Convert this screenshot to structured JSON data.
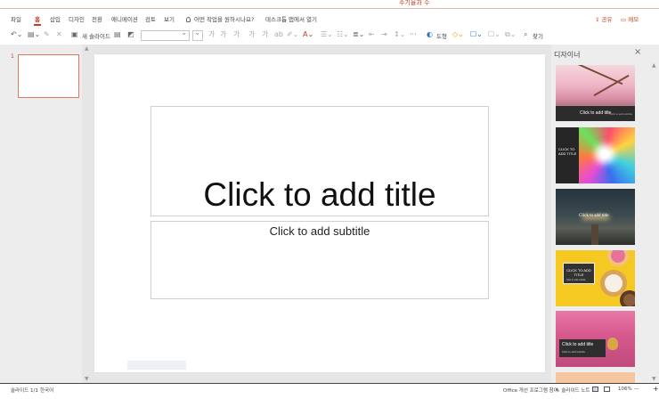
{
  "app": {
    "title": "주기율과 수",
    "accent": "#c43e1c"
  },
  "ribbon": {
    "tabs": [
      "파일",
      "홈",
      "삽입",
      "디자인",
      "전환",
      "애니메이션",
      "검토",
      "보기"
    ],
    "active_tab": "홈",
    "tell_me": "어떤 작업을 원하시나요?",
    "desktop_open": "데스크톱 앱에서 열기",
    "share": "공유",
    "memo": "메모"
  },
  "toolbar": {
    "undo_icon": "undo-icon",
    "paste_icon": "paste-icon",
    "new_slide": "새 슬라이드",
    "font_name": "",
    "font_size": "",
    "bold": "가",
    "italic": "가",
    "underline": "가",
    "strike": "가",
    "more": "···",
    "shapes": "도형",
    "find": "찾기"
  },
  "thumbnails": {
    "items": [
      {
        "number": "1"
      }
    ]
  },
  "slide": {
    "title_placeholder": "Click to add title",
    "subtitle_placeholder": "Click to add subtitle"
  },
  "designer": {
    "title": "디자이너",
    "close": "×",
    "designs": [
      {
        "caption": "Click to add title",
        "sub": "Click to add subtitle"
      },
      {
        "caption": "CLICK TO ADD TITLE",
        "sub": ""
      },
      {
        "caption": "Click to add title",
        "sub": ""
      },
      {
        "caption": "CLICK TO ADD TITLE",
        "sub": "Click to add subtitle"
      },
      {
        "caption": "Click to add title",
        "sub": "Click to add subtitle"
      }
    ]
  },
  "status": {
    "slide_counter": "슬라이드 1/1",
    "language": "한국어",
    "improve": "Office 개선 프로그램 참여",
    "notes": "슬라이드 노트",
    "zoom": "106%"
  }
}
